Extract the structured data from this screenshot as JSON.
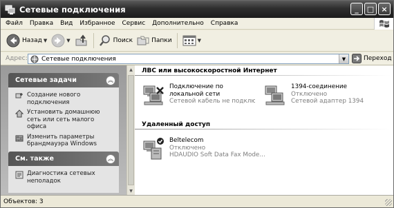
{
  "window": {
    "title": "Сетевые подключения"
  },
  "titlebar_buttons": [
    "_",
    "□",
    "×"
  ],
  "menu": [
    "Файл",
    "Правка",
    "Вид",
    "Избранное",
    "Сервис",
    "Дополнительно",
    "Справка"
  ],
  "toolbar": {
    "back_label": "Назад",
    "search_label": "Поиск",
    "folders_label": "Папки"
  },
  "address": {
    "label": "Адрес:",
    "value": "Сетевые подключения",
    "go_label": "Переход"
  },
  "network_tasks": {
    "title": "Сетевые задачи",
    "items": [
      {
        "label": "Создание нового подключения",
        "icon": "new-connection-icon"
      },
      {
        "label": "Установить домашнюю сеть или сеть малого офиса",
        "icon": "home-network-icon"
      },
      {
        "label": "Изменить параметры брандмауэра Windows",
        "icon": "firewall-icon"
      }
    ]
  },
  "see_also": {
    "title": "См. также",
    "items": [
      {
        "label": "Диагностика сетевых неполадок",
        "icon": "diagnostics-icon"
      }
    ]
  },
  "groups": [
    {
      "title": "ЛВС или высокоскоростной Интернет",
      "items": [
        {
          "name": "Подключение по локальной сети",
          "status": "Сетевой кабель не подключен",
          "icon": "lan-disconnected-icon"
        },
        {
          "name": "1394-соединение",
          "status": "Отключено",
          "detail": "Сетевой адаптер 1394",
          "icon": "lan-1394-icon"
        }
      ]
    },
    {
      "title": "Удаленный доступ",
      "items": [
        {
          "name": "Beltelecom",
          "status": "Отключено",
          "detail": "HDAUDIO Soft Data Fax Mode...",
          "icon": "dialup-modem-icon"
        }
      ]
    }
  ],
  "status_bar": {
    "text": "Объектов: 3"
  }
}
